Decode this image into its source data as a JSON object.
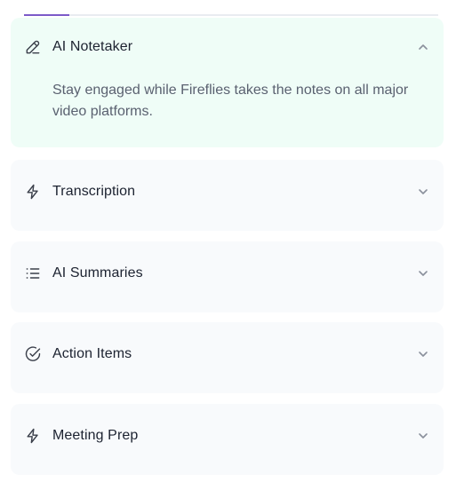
{
  "accordion": {
    "progress_fraction": 0.11,
    "accent_color": "#7c5ac8",
    "items": [
      {
        "title": "AI Notetaker",
        "icon": "pencil-icon",
        "expanded": true,
        "description": "Stay engaged while Fireflies takes the notes on all major video platforms."
      },
      {
        "title": "Transcription",
        "icon": "lightning-bolt-icon",
        "expanded": false
      },
      {
        "title": "AI Summaries",
        "icon": "list-icon",
        "expanded": false
      },
      {
        "title": "Action Items",
        "icon": "check-circle-icon",
        "expanded": false
      },
      {
        "title": "Meeting Prep",
        "icon": "lightning-bolt-icon",
        "expanded": false
      }
    ]
  }
}
